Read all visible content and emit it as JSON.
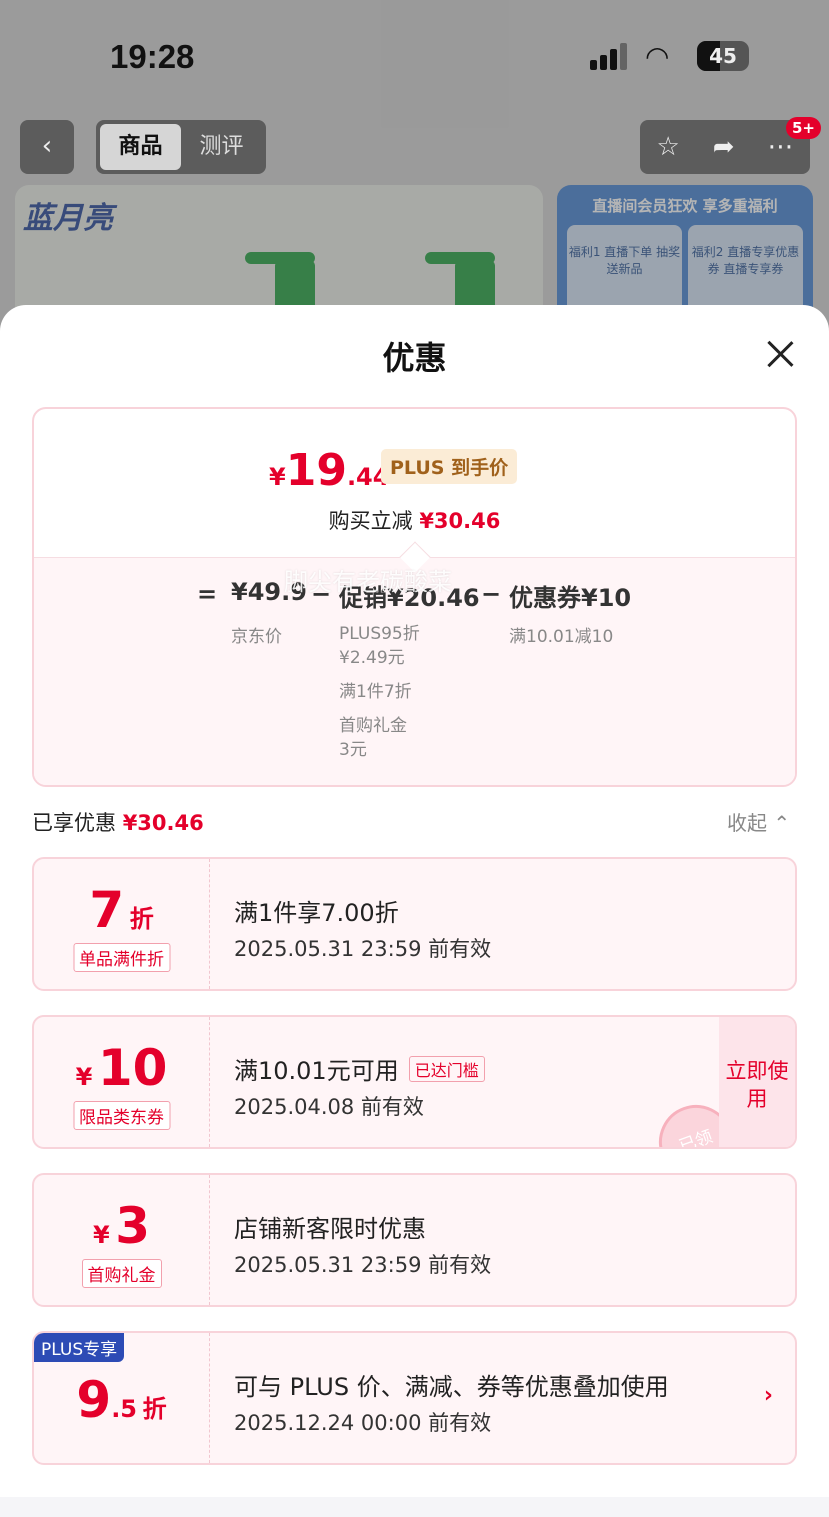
{
  "status_bar": {
    "time": "19:28",
    "battery": "45"
  },
  "nav": {
    "tabs": [
      "商品",
      "测评"
    ],
    "badge": "5+"
  },
  "background": {
    "brand_logo": "蓝月亮",
    "banner2_title": "直播间会员狂欢 享多重福利",
    "banner2_box1": "福利1 直播下单 抽奖送新品",
    "banner2_box2": "福利2 直播专享优惠券 直播专享券"
  },
  "sheet": {
    "title": "优惠"
  },
  "price_card": {
    "final_currency": "¥",
    "final_int": "19",
    "final_dec": ".44",
    "plus_tag": "PLUS 到手价",
    "reduce_label": "购买立减",
    "reduce_value": "¥30.46",
    "equals": "=",
    "jd_price": "¥49.9",
    "jd_label": "京东价",
    "minus1": "−",
    "promo": "促销¥20.46",
    "promo_sub1": "PLUS95折",
    "promo_sub1b": "¥2.49元",
    "promo_sub2": "满1件7折",
    "promo_sub3": "首购礼金",
    "promo_sub3b": "3元",
    "minus2": "−",
    "coupon": "优惠券¥10",
    "coupon_sub": "满10.01减10",
    "watermark": "脚尖有老碳酸菜"
  },
  "enjoyed": {
    "label": "已享优惠",
    "value": "¥30.46",
    "collapse": "收起"
  },
  "coupons": [
    {
      "amount": "7",
      "unit": "折",
      "tag": "单品满件折",
      "title": "满1件享7.00折",
      "date": "2025.05.31 23:59 前有效"
    },
    {
      "currency": "¥",
      "amount": "10",
      "tag": "限品类东券",
      "title": "满10.01元可用",
      "reached": "已达门槛",
      "date": "2025.04.08 前有效",
      "button": "立即使用",
      "stamp": "已领"
    },
    {
      "currency": "¥",
      "amount": "3",
      "tag": "首购礼金",
      "title": "店铺新客限时优惠",
      "date": "2025.05.31 23:59 前有效"
    },
    {
      "badge": "PLUS专享",
      "amount": "9",
      "dec": ".5",
      "unit": "折",
      "title": "可与 PLUS 价、满减、券等优惠叠加使用",
      "date": "2025.12.24 00:00 前有效",
      "arrow": "›"
    }
  ],
  "colors": {
    "accent_red": "#e4002b",
    "plus_blue": "#2d4bb5",
    "plus_gold": "#a0611b"
  }
}
